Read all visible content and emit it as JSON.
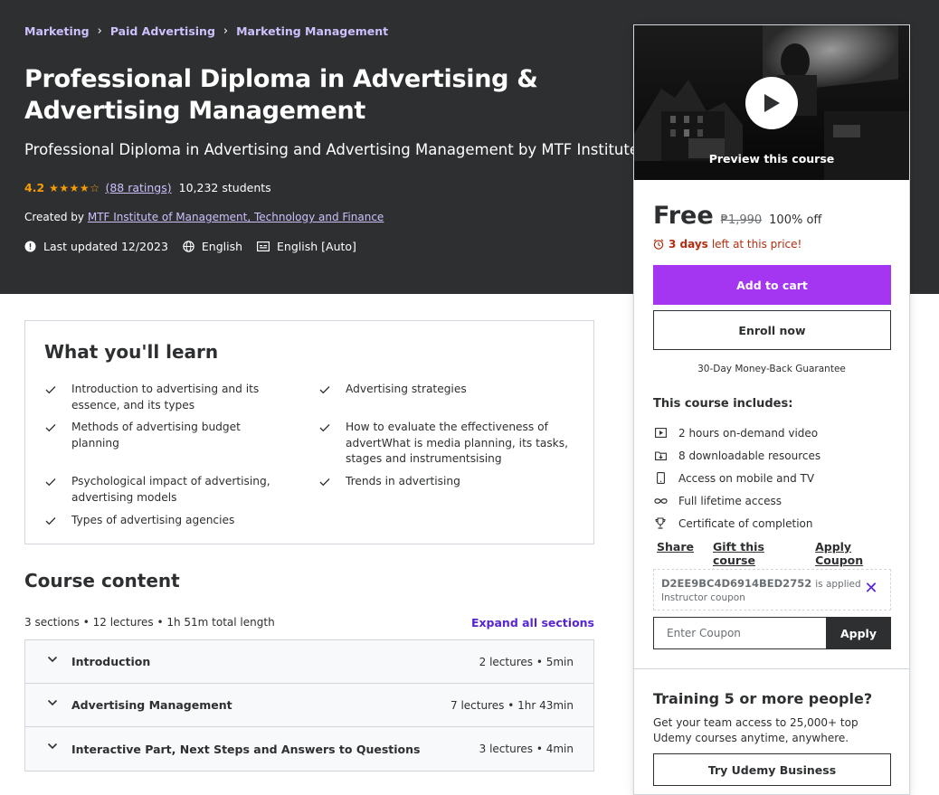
{
  "breadcrumb": [
    "Marketing",
    "Paid Advertising",
    "Marketing Management"
  ],
  "course": {
    "title": "Professional Diploma in Advertising & Advertising Management",
    "subtitle": "Professional Diploma in Advertising and Advertising Management by MTF Institute",
    "rating": "4.2",
    "rating_value": 4.2,
    "ratings_count": "(88 ratings)",
    "students": "10,232 students",
    "created_by_label": "Created by",
    "instructor": "MTF Institute of Management, Technology and Finance",
    "last_updated": "Last updated 12/2023",
    "language": "English",
    "captions": "English [Auto]"
  },
  "sidebar": {
    "preview_label": "Preview this course",
    "price": "Free",
    "original_price": "₱1,990",
    "discount": "100% off",
    "timer_days": "3 days",
    "timer_text": "left at this price!",
    "add_to_cart": "Add to cart",
    "enroll_now": "Enroll now",
    "guarantee": "30-Day Money-Back Guarantee",
    "includes_title": "This course includes:",
    "includes": [
      {
        "icon": "video-icon",
        "text": "2 hours on-demand video"
      },
      {
        "icon": "download-icon",
        "text": "8 downloadable resources"
      },
      {
        "icon": "mobile-icon",
        "text": "Access on mobile and TV"
      },
      {
        "icon": "infinity-icon",
        "text": "Full lifetime access"
      },
      {
        "icon": "trophy-icon",
        "text": "Certificate of completion"
      }
    ],
    "share": "Share",
    "gift": "Gift this course",
    "apply_coupon": "Apply Coupon",
    "coupon_code": "D2EE9BC4D6914BED2752",
    "coupon_applied": "is applied",
    "coupon_type": "Instructor coupon",
    "coupon_placeholder": "Enter Coupon",
    "apply": "Apply",
    "training_title": "Training 5 or more people?",
    "training_desc": "Get your team access to 25,000+ top Udemy courses anytime, anywhere.",
    "try_business": "Try Udemy Business"
  },
  "learn": {
    "title": "What you'll learn",
    "items": [
      "Introduction to advertising and its essence, and its types",
      "Advertising strategies",
      "Methods of advertising budget planning",
      "How to evaluate the effectiveness of advertWhat is media planning, its tasks, stages and instrumentsising",
      "Psychological impact of advertising, advertising models",
      "Trends in advertising",
      "Types of advertising agencies"
    ]
  },
  "content": {
    "title": "Course content",
    "stats": "3 sections • 12 lectures • 1h 51m total length",
    "expand_all": "Expand all sections",
    "sections": [
      {
        "title": "Introduction",
        "meta": "2 lectures • 5min"
      },
      {
        "title": "Advertising Management",
        "meta": "7 lectures • 1hr 43min"
      },
      {
        "title": "Interactive Part, Next Steps and Answers to Questions",
        "meta": "3 lectures • 4min"
      }
    ]
  },
  "colors": {
    "hero_bg": "#2d2f31",
    "accent_purple": "#a435f0",
    "link_purple": "#5624d0",
    "star_orange": "#f69c08",
    "timer_red": "#b32d0f"
  }
}
